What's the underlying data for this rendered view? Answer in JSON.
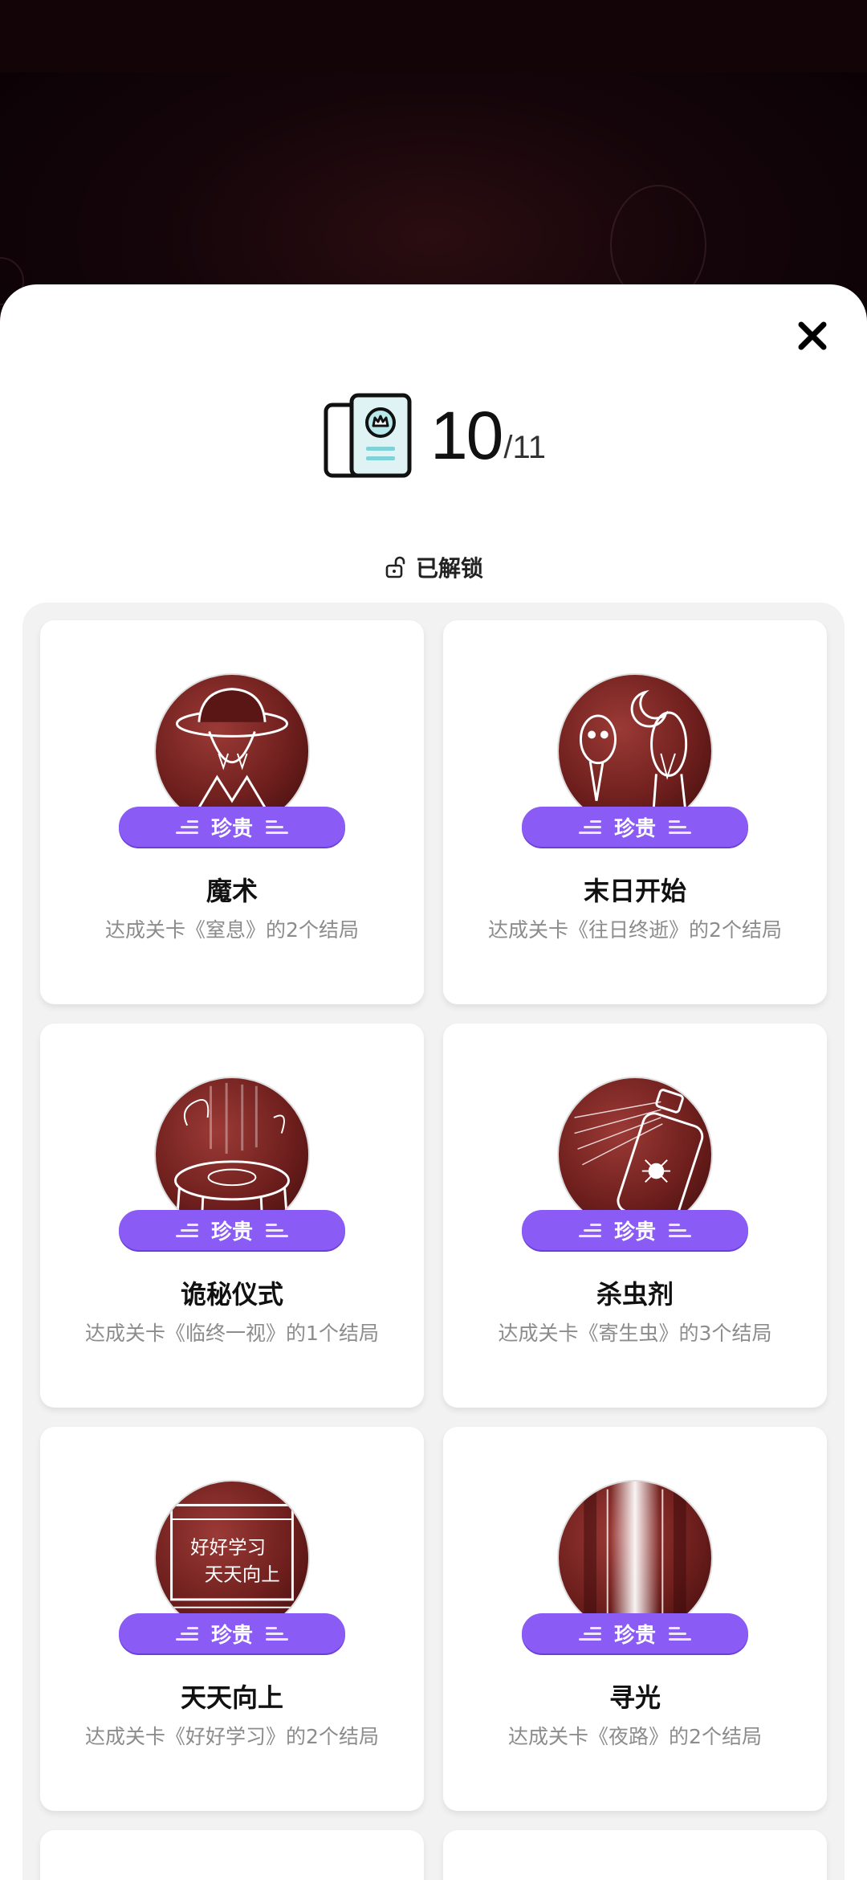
{
  "collection": {
    "unlocked_count": "10",
    "total_label": "/11",
    "filter_label": "已解锁"
  },
  "cards": [
    {
      "title": "魔术",
      "desc": "达成关卡《窒息》的2个结局",
      "rarity": "珍贵",
      "art": "hat-figure"
    },
    {
      "title": "末日开始",
      "desc": "达成关卡《往日终逝》的2个结局",
      "rarity": "珍贵",
      "art": "moon-ghosts"
    },
    {
      "title": "诡秘仪式",
      "desc": "达成关卡《临终一视》的1个结局",
      "rarity": "珍贵",
      "art": "ritual-table"
    },
    {
      "title": "杀虫剂",
      "desc": "达成关卡《寄生虫》的3个结局",
      "rarity": "珍贵",
      "art": "spray-can"
    },
    {
      "title": "天天向上",
      "desc": "达成关卡《好好学习》的2个结局",
      "rarity": "珍贵",
      "art": "blackboard",
      "art_text": [
        "好好学习",
        "天天向上"
      ]
    },
    {
      "title": "寻光",
      "desc": "达成关卡《夜路》的2个结局",
      "rarity": "珍贵",
      "art": "light-beam"
    }
  ],
  "colors": {
    "badge": "#8a5cf5",
    "avatar_bg": "#7a2522",
    "panel": "#f2f2f2"
  }
}
